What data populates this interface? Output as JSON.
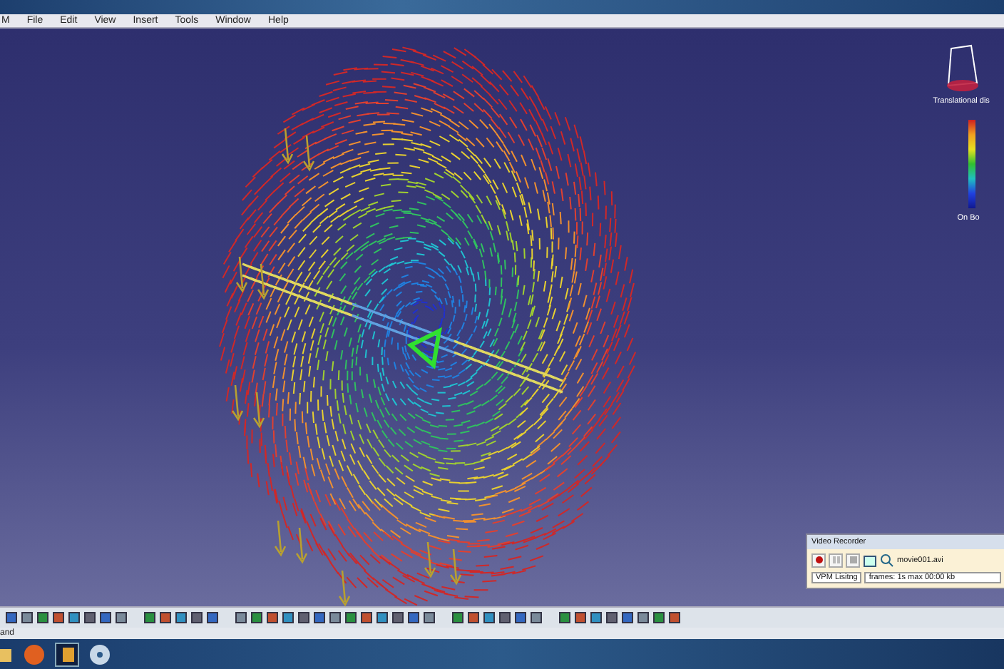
{
  "menu_bar": {
    "items": [
      "M",
      "File",
      "Edit",
      "View",
      "Insert",
      "Tools",
      "Window",
      "Help"
    ]
  },
  "legend": {
    "title": "Translational dis",
    "footer": "On Bo"
  },
  "video_recorder": {
    "title": "Video Recorder",
    "file": "movie001.avi",
    "setting": "VPM Lisitng",
    "info": "frames: 1s  max 00:00  kb"
  },
  "status_bar": {
    "text": "and"
  }
}
